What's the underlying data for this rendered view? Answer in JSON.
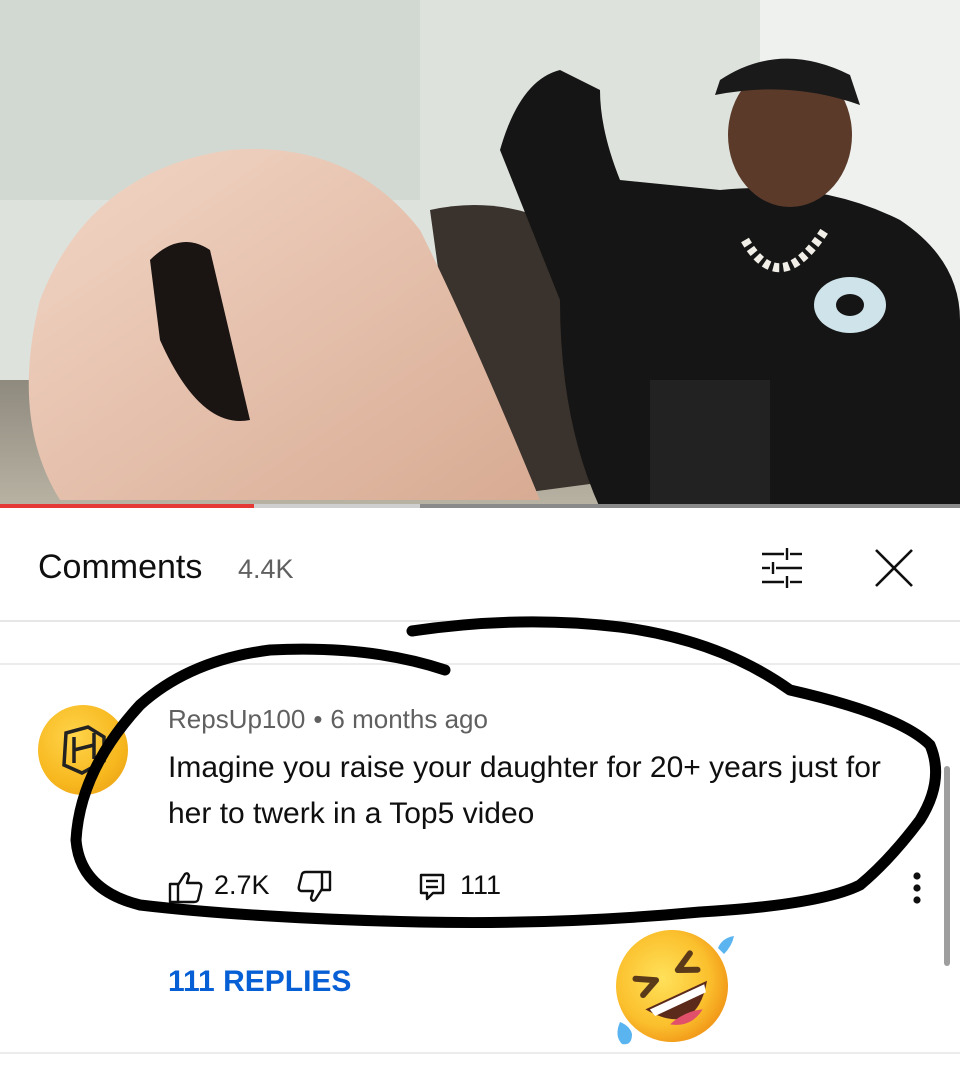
{
  "video": {
    "progress_played_fraction": 0.265,
    "progress_buffered_fraction": 0.437
  },
  "comments_header": {
    "title": "Comments",
    "count": "4.4K",
    "filter_icon": "sort-filter-icon",
    "close_icon": "close-icon"
  },
  "comment": {
    "author": "RepsUp100",
    "separator": "•",
    "time": "6 months ago",
    "text": "Imagine you raise your daughter for 20+ years just for her to twerk in a Top5 video",
    "likes": "2.7K",
    "reply_count": "111",
    "avatar_icon": "channel-logo-icon",
    "more_icon": "more-vertical-icon"
  },
  "replies_link": "111 REPLIES",
  "overlay": {
    "scribble_color": "#000000",
    "emoji_name": "rolling-on-floor-laughing-emoji"
  },
  "colors": {
    "progress": "#e53935",
    "link": "#065fd4",
    "avatar": "#f7b71e"
  }
}
